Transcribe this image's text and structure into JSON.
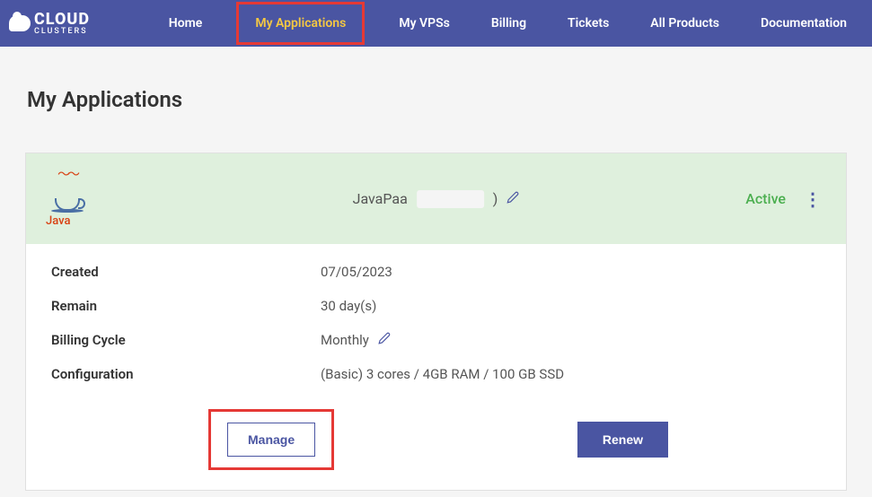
{
  "brand": {
    "line1": "CLOUD",
    "line2": "CLUSTERS"
  },
  "nav": {
    "home": "Home",
    "my_applications": "My Applications",
    "my_vpss": "My VPSs",
    "billing": "Billing",
    "tickets": "Tickets",
    "all_products": "All Products",
    "documentation": "Documentation"
  },
  "page": {
    "title": "My Applications"
  },
  "app": {
    "icon_label": "Java",
    "name_prefix": "JavaPaa",
    "name_suffix": ")",
    "status": "Active",
    "details": {
      "created_label": "Created",
      "created_value": "07/05/2023",
      "remain_label": "Remain",
      "remain_value": "30 day(s)",
      "billing_cycle_label": "Billing Cycle",
      "billing_cycle_value": "Monthly",
      "configuration_label": "Configuration",
      "configuration_value": "(Basic) 3 cores / 4GB RAM / 100 GB SSD"
    },
    "buttons": {
      "manage": "Manage",
      "renew": "Renew"
    }
  }
}
